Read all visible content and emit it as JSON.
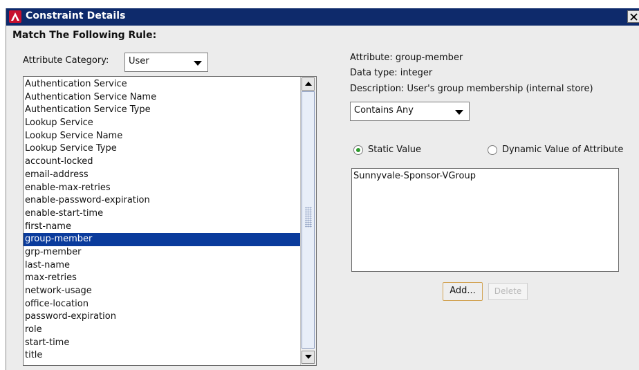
{
  "window": {
    "title": "Constraint Details",
    "close_glyph": "✕"
  },
  "rule_heading": "Match The Following Rule:",
  "category": {
    "label": "Attribute Category:",
    "selected": "User"
  },
  "attribute_list": {
    "selected_index": 12,
    "items": [
      "Authentication Service",
      "Authentication Service Name",
      "Authentication Service Type",
      "Lookup Service",
      "Lookup Service Name",
      "Lookup Service Type",
      "account-locked",
      "email-address",
      "enable-max-retries",
      "enable-password-expiration",
      "enable-start-time",
      "first-name",
      "group-member",
      "grp-member",
      "last-name",
      "max-retries",
      "network-usage",
      "office-location",
      "password-expiration",
      "role",
      "start-time",
      "title"
    ]
  },
  "details": {
    "attribute": "Attribute: group-member",
    "data_type": "Data type: integer",
    "description": "Description: User's group membership (internal store)"
  },
  "operator": {
    "selected": "Contains Any"
  },
  "value_mode": {
    "static_label": "Static Value",
    "dynamic_label": "Dynamic Value of Attribute",
    "selected": "static"
  },
  "values": [
    "Sunnyvale-Sponsor-VGroup"
  ],
  "buttons": {
    "add": "Add...",
    "delete": "Delete"
  },
  "colors": {
    "titlebar": "#0e2a6b",
    "selection": "#0a3b9c",
    "radio_selected": "#2d9b2d",
    "app_icon": "#c8102e"
  },
  "icons": {
    "app": "app-logo-icon",
    "close": "close-icon",
    "combo_arrow": "chevron-down-icon",
    "scroll_up": "scroll-up-icon",
    "scroll_down": "scroll-down-icon"
  }
}
